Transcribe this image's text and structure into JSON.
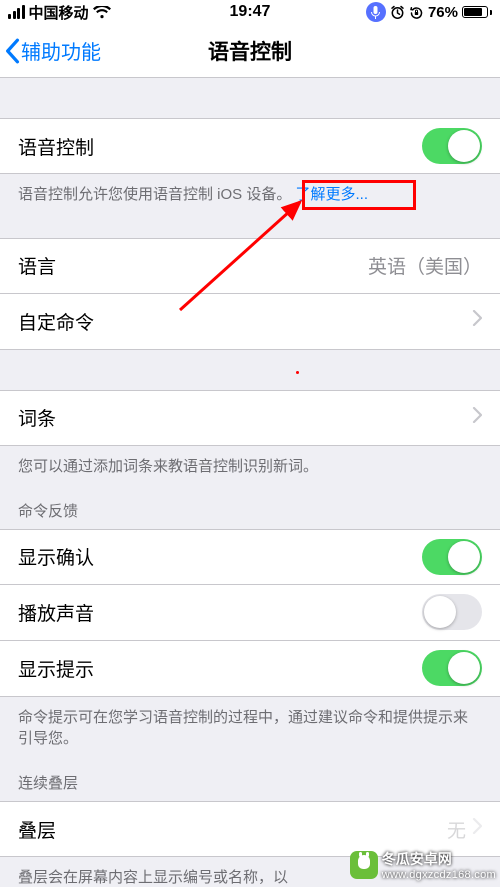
{
  "status": {
    "carrier": "中国移动",
    "time": "19:47",
    "battery_pct": "76%"
  },
  "nav": {
    "back_label": "辅助功能",
    "title": "语音控制"
  },
  "group1": {
    "toggle_label": "语音控制",
    "toggle_on": true,
    "footer_prefix": "语音控制允许您使用语音控制 iOS 设备。",
    "footer_link": "了解更多..."
  },
  "group2": {
    "language_label": "语言",
    "language_value": "英语（美国）",
    "custom_cmd_label": "自定命令"
  },
  "group3": {
    "vocab_label": "词条",
    "vocab_footer": "您可以通过添加词条来教语音控制识别新词。"
  },
  "group4": {
    "header": "命令反馈",
    "confirm_label": "显示确认",
    "confirm_on": true,
    "sound_label": "播放声音",
    "sound_on": false,
    "hints_label": "显示提示",
    "hints_on": true,
    "footer": "命令提示可在您学习语音控制的过程中，通过建议命令和提供提示来引导您。"
  },
  "group5": {
    "header": "连续叠层",
    "overlay_label": "叠层",
    "overlay_value": "无",
    "overlay_footer_partial": "叠层会在屏幕内容上显示编号或名称，以"
  },
  "watermark": {
    "name": "冬瓜安卓网",
    "url": "www.dgxzcdz168.com"
  }
}
